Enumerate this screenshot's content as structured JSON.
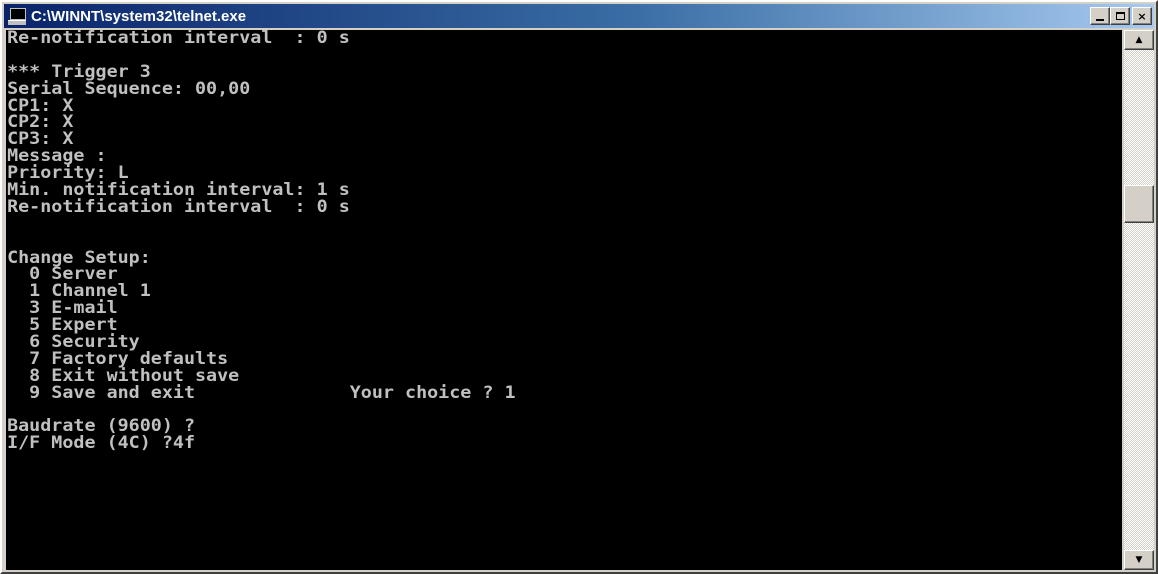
{
  "window": {
    "title": "C:\\WINNT\\system32\\telnet.exe",
    "close_glyph": "×",
    "scroll_up_glyph": "▲",
    "scroll_down_glyph": "▼"
  },
  "console": {
    "lines": [
      "Re-notification interval  : 0 s",
      "",
      "*** Trigger 3",
      "Serial Sequence: 00,00",
      "CP1: X",
      "CP2: X",
      "CP3: X",
      "Message :",
      "Priority: L",
      "Min. notification interval: 1 s",
      "Re-notification interval  : 0 s",
      "",
      "",
      "Change Setup:",
      "  0 Server",
      "  1 Channel 1",
      "  3 E-mail",
      "  5 Expert",
      "  6 Security",
      "  7 Factory defaults",
      "  8 Exit without save",
      "  9 Save and exit              Your choice ? 1",
      "",
      "Baudrate (9600) ?",
      "I/F Mode (4C) ?4f"
    ]
  },
  "colors": {
    "console_bg": "#000000",
    "console_fg": "#c0c0c0",
    "titlebar_start": "#0a246a",
    "titlebar_end": "#a6caf0"
  },
  "icons": {
    "app": "console-window-icon",
    "minimize": "minimize-icon",
    "maximize": "maximize-icon",
    "close": "close-icon"
  }
}
